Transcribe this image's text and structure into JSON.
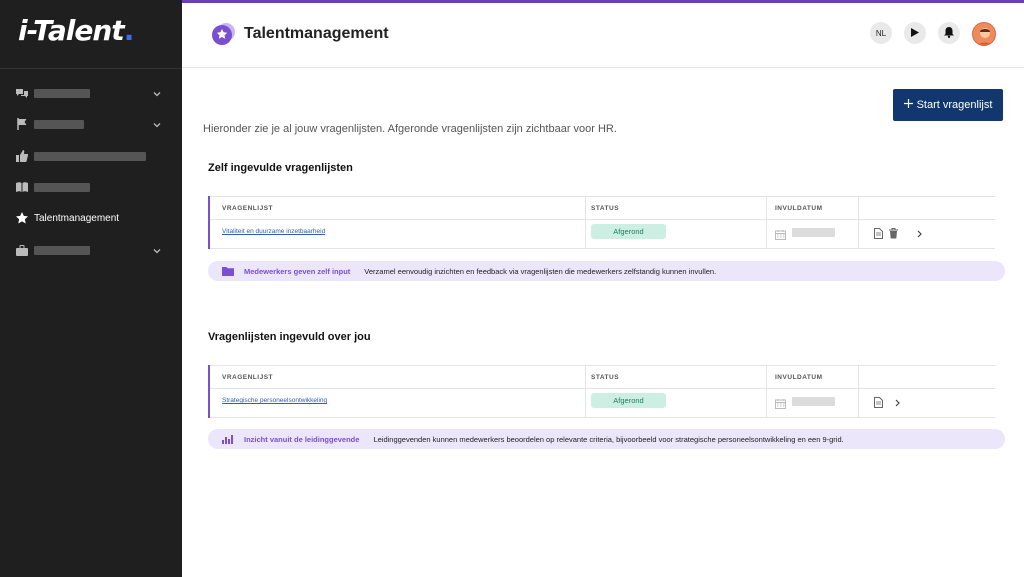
{
  "brand": {
    "logo": "i-Talent",
    "dot": ".",
    "accent": "#6a3fb8"
  },
  "sidebar": {
    "items": [
      {
        "icon": "chat-bubbles-icon",
        "label": "",
        "expandable": true
      },
      {
        "icon": "flag-icon",
        "label": "",
        "expandable": true
      },
      {
        "icon": "thumbs-up-icon",
        "label": "",
        "expandable": false
      },
      {
        "icon": "book-icon",
        "label": "",
        "expandable": false
      },
      {
        "icon": "star-icon",
        "label": "Talentmanagement",
        "expandable": false,
        "active": true
      },
      {
        "icon": "briefcase-icon",
        "label": "",
        "expandable": true
      }
    ]
  },
  "header": {
    "title": "Talentmanagement",
    "language": "NL",
    "play_icon": "play-icon",
    "bell_icon": "bell-icon"
  },
  "main": {
    "start_button": "Start vragenlijst",
    "intro": "Hieronder zie je al jouw vragenlijsten. Afgeronde vragenlijsten zijn zichtbaar voor HR.",
    "sections": [
      {
        "title": "Zelf ingevulde vragenlijsten",
        "columns": [
          "VRAGENLIJST",
          "STATUS",
          "INVULDATUM"
        ],
        "row": {
          "name": "Vitaliteit en duurzame inzetbaarheid",
          "status": "Afgerond"
        },
        "info_title": "Medewerkers geven zelf input",
        "info_text": "Verzamel eenvoudig inzichten en feedback via vragenlijsten die medewerkers zelfstandig kunnen invullen."
      },
      {
        "title": "Vragenlijsten ingevuld over jou",
        "columns": [
          "VRAGENLIJST",
          "STATUS",
          "INVULDATUM"
        ],
        "row": {
          "name": "Strategische personeelsontwikkeling",
          "status": "Afgerond"
        },
        "info_title": "Inzicht vanuit de leidinggevende",
        "info_text": "Leidinggevenden kunnen medewerkers beoordelen op relevante criteria, bijvoorbeeld voor strategische personeelsontwikkeling en een 9-grid."
      }
    ]
  },
  "colors": {
    "primary": "#11376e",
    "status_bg": "#cdeee3",
    "status_fg": "#1b7f5f",
    "info_bg": "#ece6fa",
    "purple": "#7a4fd0"
  }
}
